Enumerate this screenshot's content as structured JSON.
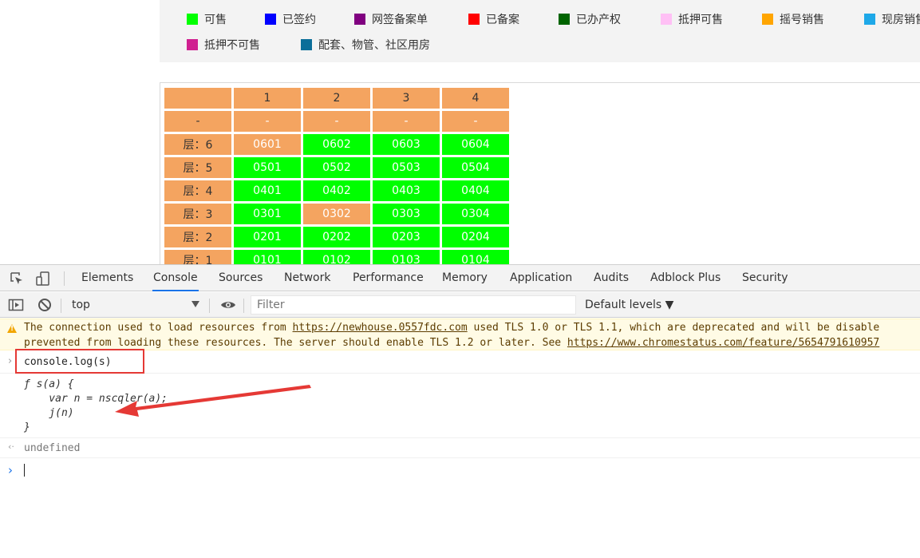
{
  "legend": {
    "items": [
      {
        "label": "可售",
        "color": "#00ff00"
      },
      {
        "label": "已签约",
        "color": "#0000ff"
      },
      {
        "label": "网签备案单",
        "color": "#800080"
      },
      {
        "label": "已备案",
        "color": "#ff0000"
      },
      {
        "label": "已办产权",
        "color": "#006400"
      },
      {
        "label": "抵押可售",
        "color": "#ffc0f5"
      },
      {
        "label": "摇号销售",
        "color": "#ffa500"
      },
      {
        "label": "现房销售",
        "color": "#1ea8e8"
      },
      {
        "label": "抵押不可售",
        "color": "#d02090"
      },
      {
        "label": "配套、物管、社区用房",
        "color": "#0b6e99"
      }
    ]
  },
  "grid": {
    "header": [
      "",
      "1",
      "2",
      "3",
      "4"
    ],
    "subheader": [
      "-",
      "-",
      "-",
      "-",
      "-"
    ],
    "rows": [
      {
        "floor": "层：6",
        "units": [
          {
            "id": "0601",
            "status": "orange"
          },
          {
            "id": "0602",
            "status": "green"
          },
          {
            "id": "0603",
            "status": "green"
          },
          {
            "id": "0604",
            "status": "green"
          }
        ]
      },
      {
        "floor": "层：5",
        "units": [
          {
            "id": "0501",
            "status": "green"
          },
          {
            "id": "0502",
            "status": "green"
          },
          {
            "id": "0503",
            "status": "green"
          },
          {
            "id": "0504",
            "status": "green"
          }
        ]
      },
      {
        "floor": "层：4",
        "units": [
          {
            "id": "0401",
            "status": "green"
          },
          {
            "id": "0402",
            "status": "green"
          },
          {
            "id": "0403",
            "status": "green"
          },
          {
            "id": "0404",
            "status": "green"
          }
        ]
      },
      {
        "floor": "层：3",
        "units": [
          {
            "id": "0301",
            "status": "green"
          },
          {
            "id": "0302",
            "status": "orange"
          },
          {
            "id": "0303",
            "status": "green"
          },
          {
            "id": "0304",
            "status": "green"
          }
        ]
      },
      {
        "floor": "层：2",
        "units": [
          {
            "id": "0201",
            "status": "green"
          },
          {
            "id": "0202",
            "status": "green"
          },
          {
            "id": "0203",
            "status": "green"
          },
          {
            "id": "0204",
            "status": "green"
          }
        ]
      },
      {
        "floor": "层：1",
        "units": [
          {
            "id": "0101",
            "status": "green"
          },
          {
            "id": "0102",
            "status": "green"
          },
          {
            "id": "0103",
            "status": "green"
          },
          {
            "id": "0104",
            "status": "green"
          }
        ]
      }
    ]
  },
  "devtools": {
    "tabs": [
      "Elements",
      "Console",
      "Sources",
      "Network",
      "Performance",
      "Memory",
      "Application",
      "Audits",
      "Adblock Plus",
      "Security"
    ],
    "active_tab": "Console",
    "toolbar": {
      "context": "top",
      "filter_placeholder": "Filter",
      "levels": "Default levels ▼"
    },
    "warning": {
      "line1_pre": "The connection used to load resources from ",
      "line1_link": "https://newhouse.0557fdc.com",
      "line1_post": " used TLS 1.0 or TLS 1.1, which are deprecated and will be disable",
      "line2_pre": "prevented from loading these resources. The server should enable TLS 1.2 or later. See ",
      "line2_link": "https://www.chromestatus.com/feature/5654791610957"
    },
    "command": "console.log(s)",
    "output_lines": [
      "ƒ s(a) {",
      "    var n = nscqler(a);",
      "    j(n)",
      "}"
    ],
    "result": "undefined"
  }
}
